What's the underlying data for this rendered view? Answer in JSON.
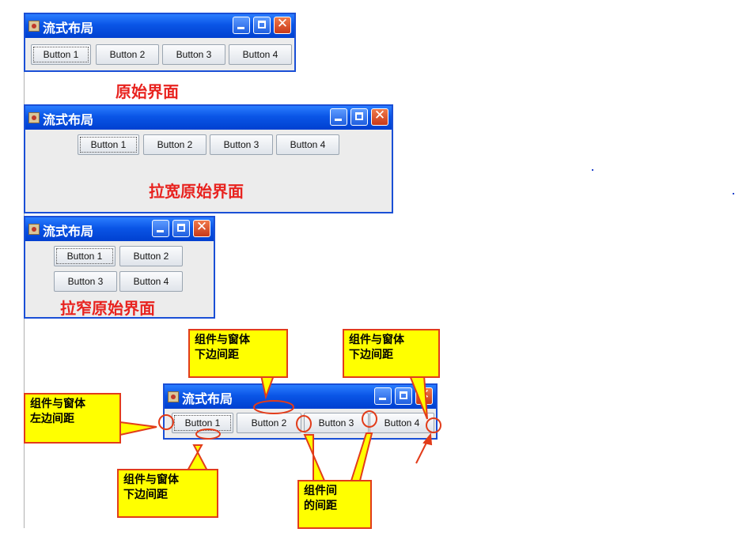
{
  "window_title": "流式布局",
  "buttons": [
    "Button 1",
    "Button 2",
    "Button 3",
    "Button 4"
  ],
  "labels": {
    "original": "原始界面",
    "wider": "拉宽原始界面",
    "narrower": "拉窄原始界面"
  },
  "callouts": {
    "left_gap": "组件与窗体\n左边间距",
    "top_gap": "组件与窗体\n下边间距",
    "right_gap": "组件与窗体\n下边间距",
    "bottom_gap": "组件与窗体\n下边间距",
    "between_gap": "组件间\n的间距"
  },
  "colors": {
    "title_bar": "#0a55e6",
    "label_red": "#e8231f",
    "callout_fill": "#ffff00",
    "callout_border": "#e23c1a"
  }
}
